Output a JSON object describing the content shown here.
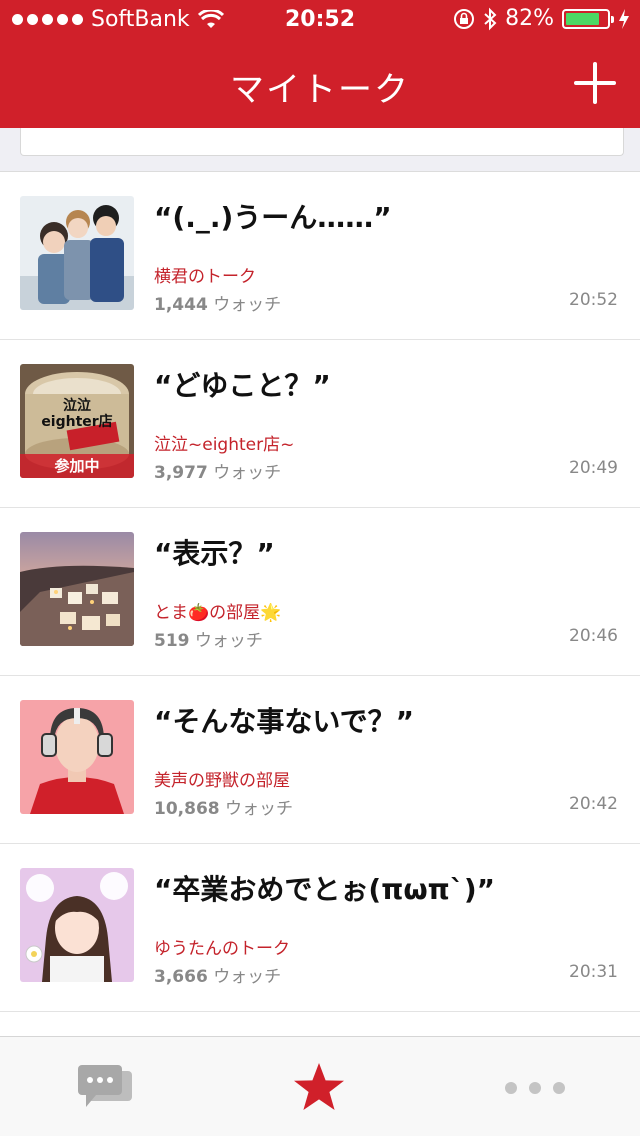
{
  "status_bar": {
    "carrier": "SoftBank",
    "time": "20:52",
    "battery": "82%",
    "battery_level": 0.82
  },
  "nav": {
    "title": "マイトーク"
  },
  "talks": [
    {
      "title": "“(._.)うーん……”",
      "room": "横君のトーク",
      "watch_count": "1,444",
      "watch_label": "ウォッチ",
      "time": "20:52"
    },
    {
      "title": "“どゆこと？”",
      "room": "泣泣~eighter店~",
      "watch_count": "3,977",
      "watch_label": "ウォッチ",
      "time": "20:49",
      "thumb_text1": "泣泣",
      "thumb_text2": "eighter店",
      "badge": "参加中"
    },
    {
      "title": "“表示？”",
      "room": "とま🍅の部屋🌟",
      "watch_count": "519",
      "watch_label": "ウォッチ",
      "time": "20:46"
    },
    {
      "title": "“そんな事ないで？”",
      "room": "美声の野獣の部屋",
      "watch_count": "10,868",
      "watch_label": "ウォッチ",
      "time": "20:42"
    },
    {
      "title": "“卒業おめでとぉ(πωπ`)”",
      "room": "ゆうたんのトーク",
      "watch_count": "3,666",
      "watch_label": "ウォッチ",
      "time": "20:31"
    }
  ],
  "colors": {
    "brand_red": "#d0202a",
    "room_text": "#c4232b",
    "meta_text": "#888888"
  },
  "tabbar": {
    "items": [
      {
        "icon": "chat-bubbles-icon",
        "active": false
      },
      {
        "icon": "star-icon",
        "active": true
      },
      {
        "icon": "more-icon",
        "active": false
      }
    ]
  }
}
